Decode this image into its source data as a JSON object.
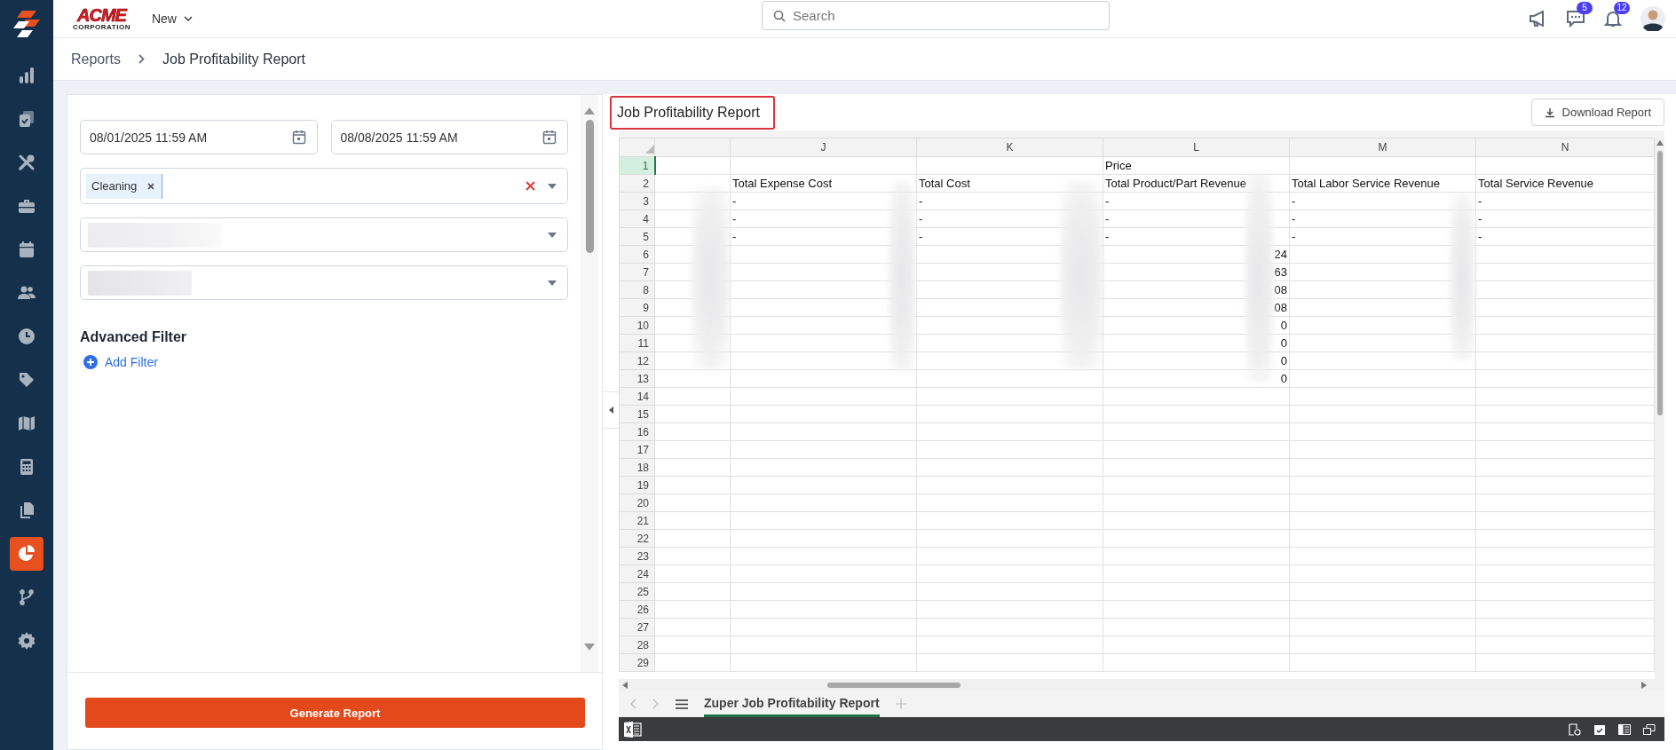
{
  "sidebar": {
    "items": [
      {
        "kind": "dashboard",
        "selected": false
      },
      {
        "kind": "tasks",
        "selected": false
      },
      {
        "kind": "tools",
        "selected": false
      },
      {
        "kind": "briefcase",
        "selected": false
      },
      {
        "kind": "calendar",
        "selected": false
      },
      {
        "kind": "users",
        "selected": false
      },
      {
        "kind": "clock",
        "selected": false
      },
      {
        "kind": "tag",
        "selected": false
      },
      {
        "kind": "map",
        "selected": false
      },
      {
        "kind": "calculator",
        "selected": false
      },
      {
        "kind": "documents",
        "selected": false
      },
      {
        "kind": "reports",
        "selected": true
      },
      {
        "kind": "workflow",
        "selected": false
      },
      {
        "kind": "settings",
        "selected": false
      }
    ]
  },
  "topbar": {
    "logo": {
      "word": "ACME",
      "subtitle": "CORPORATION"
    },
    "new_menu": {
      "label": "New"
    },
    "search": {
      "placeholder": "Search"
    },
    "actions": [
      {
        "kind": "announcements"
      },
      {
        "kind": "messages",
        "badge": "5"
      },
      {
        "kind": "notifications",
        "badge": "12"
      },
      {
        "kind": "avatar"
      }
    ]
  },
  "breadcrumb": [
    {
      "label": "Reports",
      "selected": false
    },
    {
      "label": "Job Profitability Report",
      "selected": true
    }
  ],
  "filters": {
    "start_date": "08/01/2025 11:59 AM",
    "end_date": "08/08/2025 11:59 AM",
    "categories": {
      "tags": [
        {
          "label": "Cleaning"
        }
      ]
    },
    "selects": [
      {
        "kind": "blurred"
      },
      {
        "kind": "blurred"
      }
    ],
    "advanced_filter": {
      "title": "Advanced Filter",
      "add_label": "Add Filter"
    },
    "generate_button": "Generate Report"
  },
  "report": {
    "title": "Job Profitability Report",
    "download_label": "Download Report",
    "sheet": {
      "columns": [
        "J",
        "K",
        "L",
        "M",
        "N"
      ],
      "rows": [
        {
          "number": "1",
          "selected": true,
          "cells": [
            null,
            null,
            {
              "text": "Price",
              "kind": "text"
            },
            null,
            null
          ]
        },
        {
          "number": "2",
          "selected": false,
          "cells": [
            {
              "text": "Total Expense Cost",
              "kind": "text"
            },
            {
              "text": "Total Cost",
              "kind": "text"
            },
            {
              "text": "Total Product/Part Revenue",
              "kind": "text"
            },
            {
              "text": "Total Labor Service Revenue",
              "kind": "text"
            },
            {
              "text": "Total Service Revenue",
              "kind": "text"
            }
          ]
        },
        {
          "number": "3",
          "selected": false,
          "cells": [
            {
              "text": "-",
              "kind": "text"
            },
            {
              "text": "-",
              "kind": "text"
            },
            {
              "text": "-",
              "kind": "text"
            },
            {
              "text": "-",
              "kind": "text"
            },
            {
              "text": "-",
              "kind": "text"
            }
          ]
        },
        {
          "number": "4",
          "selected": false,
          "cells": [
            {
              "text": "-",
              "kind": "text"
            },
            {
              "text": "-",
              "kind": "text"
            },
            {
              "text": "-",
              "kind": "text"
            },
            {
              "text": "-",
              "kind": "text"
            },
            {
              "text": "-",
              "kind": "text"
            }
          ]
        },
        {
          "number": "5",
          "selected": false,
          "cells": [
            {
              "text": "-",
              "kind": "text"
            },
            {
              "text": "-",
              "kind": "text"
            },
            {
              "text": "-",
              "kind": "text"
            },
            {
              "text": "-",
              "kind": "text"
            },
            {
              "text": "-",
              "kind": "text"
            }
          ]
        },
        {
          "number": "6",
          "selected": false,
          "cells": [
            null,
            null,
            {
              "text": "24",
              "kind": "number"
            },
            null,
            null
          ]
        },
        {
          "number": "7",
          "selected": false,
          "cells": [
            null,
            null,
            {
              "text": "63",
              "kind": "number"
            },
            null,
            null
          ]
        },
        {
          "number": "8",
          "selected": false,
          "cells": [
            null,
            null,
            {
              "text": "08",
              "kind": "number"
            },
            null,
            null
          ]
        },
        {
          "number": "9",
          "selected": false,
          "cells": [
            null,
            null,
            {
              "text": "08",
              "kind": "number"
            },
            null,
            null
          ]
        },
        {
          "number": "10",
          "selected": false,
          "cells": [
            null,
            null,
            {
              "text": "0",
              "kind": "number"
            },
            null,
            null
          ]
        },
        {
          "number": "11",
          "selected": false,
          "cells": [
            null,
            null,
            {
              "text": "0",
              "kind": "number"
            },
            null,
            null
          ]
        },
        {
          "number": "12",
          "selected": false,
          "cells": [
            null,
            null,
            {
              "text": "0",
              "kind": "number"
            },
            null,
            null
          ]
        },
        {
          "number": "13",
          "selected": false,
          "cells": [
            null,
            null,
            {
              "text": "0",
              "kind": "number"
            },
            null,
            null
          ]
        },
        {
          "number": "14",
          "selected": false,
          "cells": [
            null,
            null,
            null,
            null,
            null
          ]
        },
        {
          "number": "15",
          "selected": false,
          "cells": [
            null,
            null,
            null,
            null,
            null
          ]
        },
        {
          "number": "16",
          "selected": false,
          "cells": [
            null,
            null,
            null,
            null,
            null
          ]
        },
        {
          "number": "17",
          "selected": false,
          "cells": [
            null,
            null,
            null,
            null,
            null
          ]
        },
        {
          "number": "18",
          "selected": false,
          "cells": [
            null,
            null,
            null,
            null,
            null
          ]
        },
        {
          "number": "19",
          "selected": false,
          "cells": [
            null,
            null,
            null,
            null,
            null
          ]
        },
        {
          "number": "20",
          "selected": false,
          "cells": [
            null,
            null,
            null,
            null,
            null
          ]
        },
        {
          "number": "21",
          "selected": false,
          "cells": [
            null,
            null,
            null,
            null,
            null
          ]
        },
        {
          "number": "22",
          "selected": false,
          "cells": [
            null,
            null,
            null,
            null,
            null
          ]
        },
        {
          "number": "23",
          "selected": false,
          "cells": [
            null,
            null,
            null,
            null,
            null
          ]
        },
        {
          "number": "24",
          "selected": false,
          "cells": [
            null,
            null,
            null,
            null,
            null
          ]
        },
        {
          "number": "25",
          "selected": false,
          "cells": [
            null,
            null,
            null,
            null,
            null
          ]
        },
        {
          "number": "26",
          "selected": false,
          "cells": [
            null,
            null,
            null,
            null,
            null
          ]
        },
        {
          "number": "27",
          "selected": false,
          "cells": [
            null,
            null,
            null,
            null,
            null
          ]
        },
        {
          "number": "28",
          "selected": false,
          "cells": [
            null,
            null,
            null,
            null,
            null
          ]
        },
        {
          "number": "29",
          "selected": false,
          "cells": [
            null,
            null,
            null,
            null,
            null
          ]
        }
      ],
      "tabs": [
        {
          "label": "Zuper Job Profitability Report",
          "selected": true
        }
      ]
    }
  }
}
